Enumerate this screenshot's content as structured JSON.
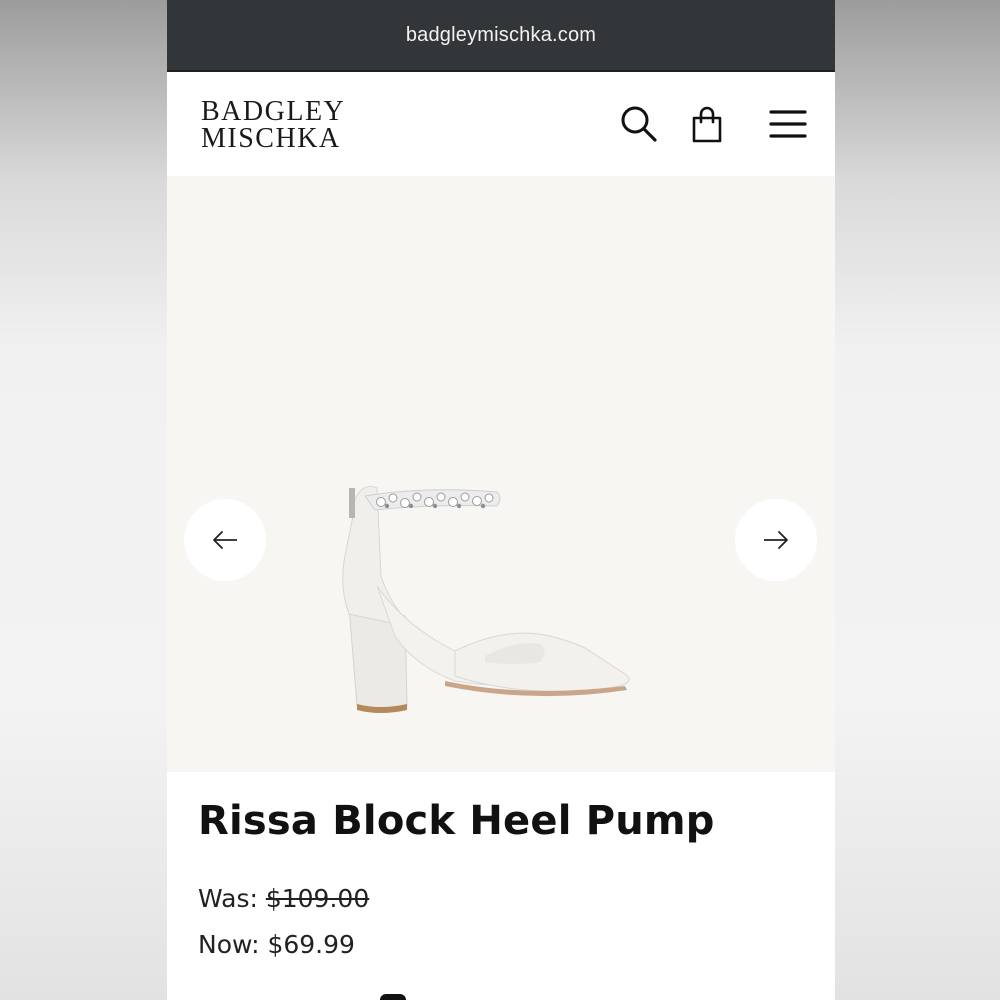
{
  "browser": {
    "url": "badgleymischka.com"
  },
  "header": {
    "logo_line1": "BADGLEY",
    "logo_line2": "MISCHKA",
    "icons": [
      "search-icon",
      "shopping-bag-icon",
      "hamburger-menu-icon"
    ]
  },
  "gallery": {
    "prev_icon": "arrow-left-icon",
    "next_icon": "arrow-right-icon"
  },
  "product": {
    "title": "Rissa Block Heel Pump",
    "was_label": "Was:",
    "was_price": "$109.00",
    "now_label": "Now:",
    "now_price": "$69.99"
  },
  "colors": {
    "url_bar": "#333638",
    "gallery_bg": "#f7f6f3",
    "text": "#111111"
  }
}
